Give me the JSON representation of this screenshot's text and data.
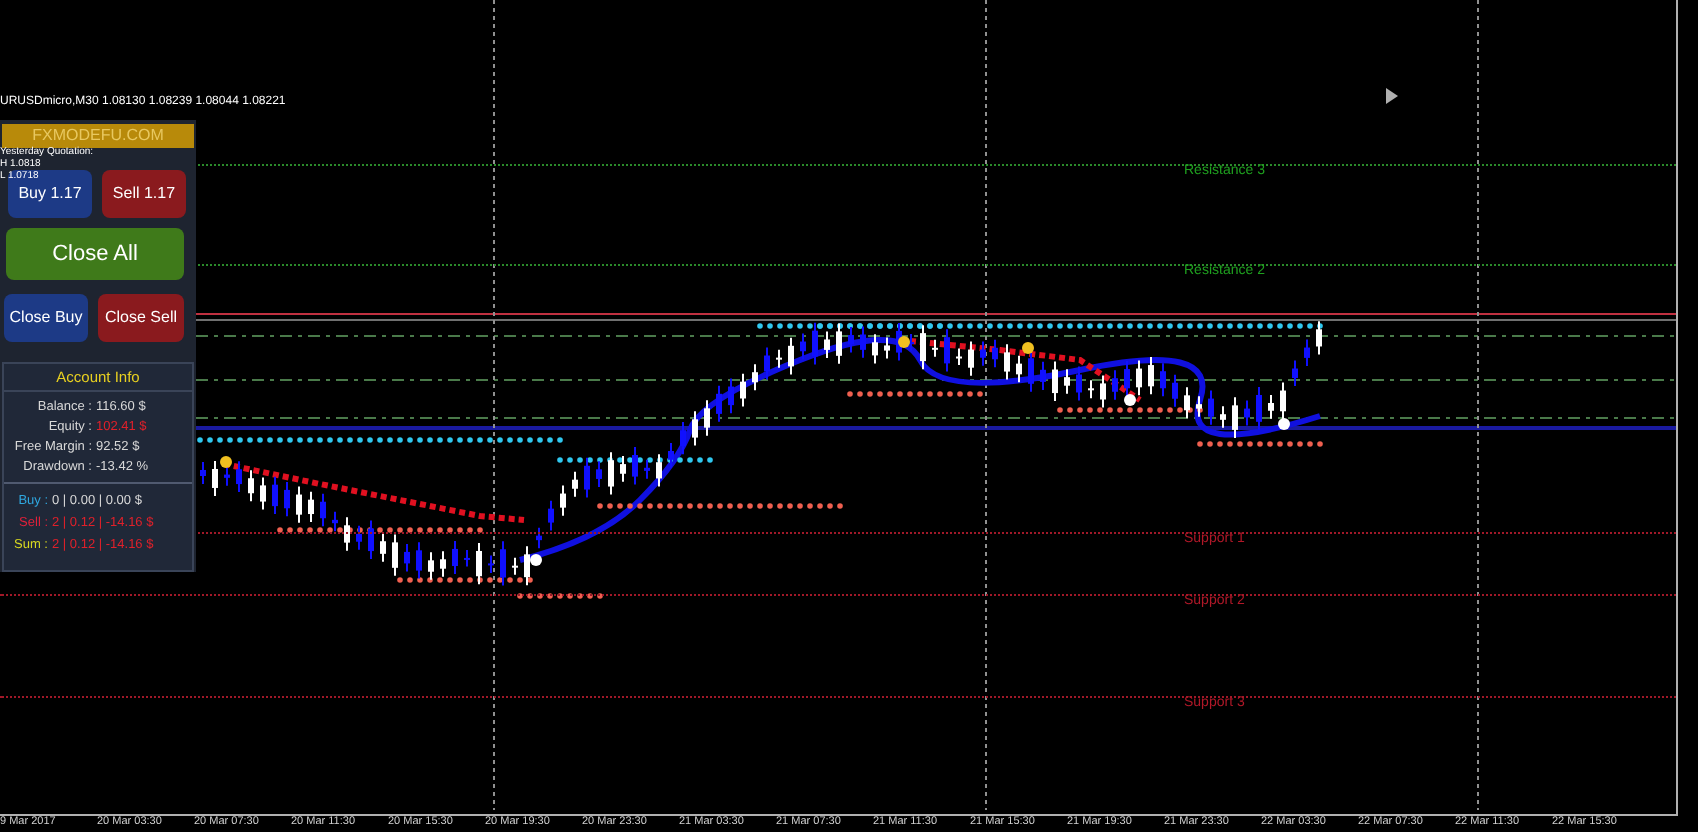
{
  "chart_title": "URUSDmicro,M30 1.08130 1.08239 1.08044 1.08221",
  "panel": {
    "logo": "FXMODEFU.COM",
    "quotation": {
      "title": "Yesterday Quotation:",
      "high": "H 1.0818",
      "low": "L 1.0718"
    },
    "buttons": [
      {
        "label": "Buy 1.17",
        "kind": "buy"
      },
      {
        "label": "Sell 1.17",
        "kind": "sell"
      },
      {
        "label": "Close All",
        "kind": "all"
      },
      {
        "label": "Close Buy",
        "kind": "buy"
      },
      {
        "label": "Close Sell",
        "kind": "sell"
      }
    ],
    "account": {
      "title": "Account Info",
      "rows": [
        {
          "label": "Balance :",
          "value": "116.60 $",
          "color": "#d8d8d8"
        },
        {
          "label": "Equity :",
          "value": "102.41 $",
          "color": "#e0202a"
        },
        {
          "label": "Free Margin :",
          "value": "92.52 $",
          "color": "#d8d8d8"
        },
        {
          "label": "Drawdown :",
          "value": "-13.42 %",
          "color": "#d8d8d8"
        }
      ],
      "positions": [
        {
          "label": "Buy :",
          "value": "0 | 0.00 | 0.00 $",
          "color": "#2fa8e0",
          "kind": "flat"
        },
        {
          "label": "Sell :",
          "value": "2 | 0.12 | -14.16 $",
          "color": "#e0203a",
          "kind": "loss"
        },
        {
          "label": "Sum :",
          "value": "2 | 0.12 | -14.16 $",
          "color": "#d8d820",
          "kind": "loss"
        }
      ]
    }
  },
  "levels": [
    {
      "label": "Resistance 3",
      "kind": "resistance"
    },
    {
      "label": "Resistance 2",
      "kind": "resistance"
    },
    {
      "label": "Support 1",
      "kind": "support"
    },
    {
      "label": "Support 2",
      "kind": "support"
    },
    {
      "label": "Support 3",
      "kind": "support"
    }
  ],
  "time_axis": [
    "9 Mar 2017",
    "20 Mar 03:30",
    "20 Mar 07:30",
    "20 Mar 11:30",
    "20 Mar 15:30",
    "20 Mar 19:30",
    "20 Mar 23:30",
    "21 Mar 03:30",
    "21 Mar 07:30",
    "21 Mar 11:30",
    "21 Mar 15:30",
    "21 Mar 19:30",
    "21 Mar 23:30",
    "22 Mar 03:30",
    "22 Mar 07:30",
    "22 Mar 11:30",
    "22 Mar 15:30"
  ]
}
